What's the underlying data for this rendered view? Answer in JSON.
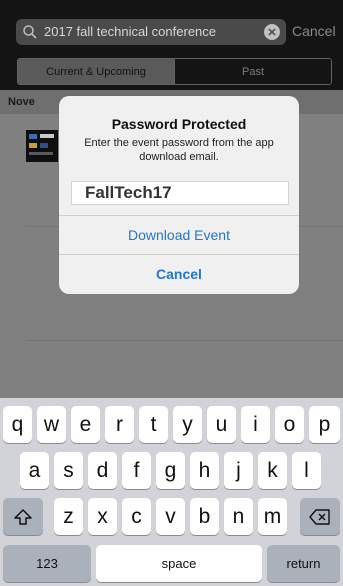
{
  "search": {
    "query": "2017 fall technical conference",
    "cancel_label": "Cancel"
  },
  "segments": {
    "current": "Current & Upcoming",
    "past": "Past"
  },
  "list": {
    "section_label": "Nove"
  },
  "alert": {
    "title": "Password Protected",
    "message": "Enter the event password from the app download email.",
    "password_value": "FallTech17",
    "download_label": "Download Event",
    "cancel_label": "Cancel"
  },
  "keyboard": {
    "row1": [
      "q",
      "w",
      "e",
      "r",
      "t",
      "y",
      "u",
      "i",
      "o",
      "p"
    ],
    "row2": [
      "a",
      "s",
      "d",
      "f",
      "g",
      "h",
      "j",
      "k",
      "l"
    ],
    "row3": [
      "z",
      "x",
      "c",
      "v",
      "b",
      "n",
      "m"
    ],
    "numbers_label": "123",
    "space_label": "space",
    "return_label": "return",
    "shift_icon": "shift-icon",
    "delete_icon": "backspace-icon"
  },
  "colors": {
    "accent": "#1f78d1",
    "header_bg": "#141414"
  }
}
